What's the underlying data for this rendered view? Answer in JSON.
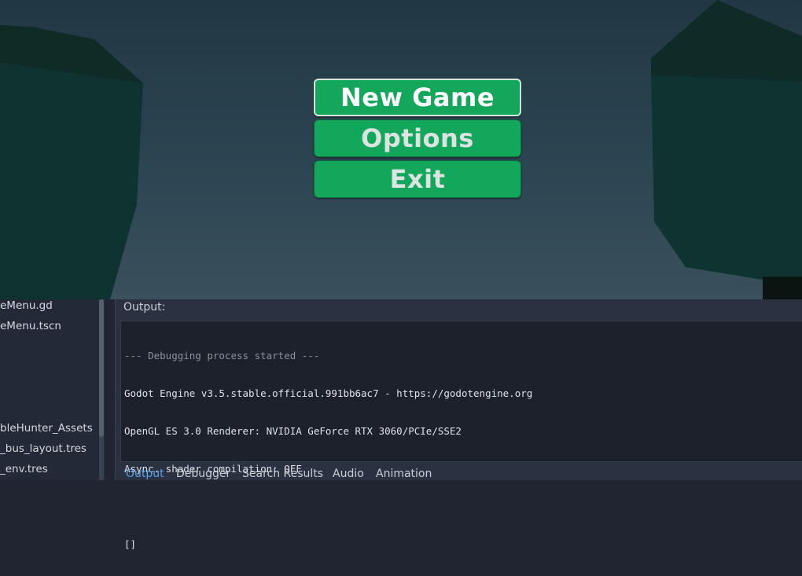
{
  "game": {
    "menu": {
      "new_game_label": "New Game",
      "options_label": "Options",
      "exit_label": "Exit",
      "button_color": "#12a75a"
    }
  },
  "filesystem": {
    "items": [
      "eMenu.gd",
      "eMenu.tscn",
      "bleHunter_Assets",
      "_bus_layout.tres",
      "_env.tres"
    ]
  },
  "bottom_panel": {
    "output_label": "Output:",
    "log_lines": [
      "--- Debugging process started ---",
      "Godot Engine v3.5.stable.official.991bb6ac7 - https://godotengine.org",
      "OpenGL ES 3.0 Renderer: NVIDIA GeForce RTX 3060/PCIe/SSE2",
      "Async. shader compilation: OFF",
      "",
      "[]"
    ],
    "tabs": [
      "Output",
      "Debugger",
      "Search Results",
      "Audio",
      "Animation"
    ],
    "active_tab": "Output",
    "accent_color": "#5ba3ef"
  }
}
